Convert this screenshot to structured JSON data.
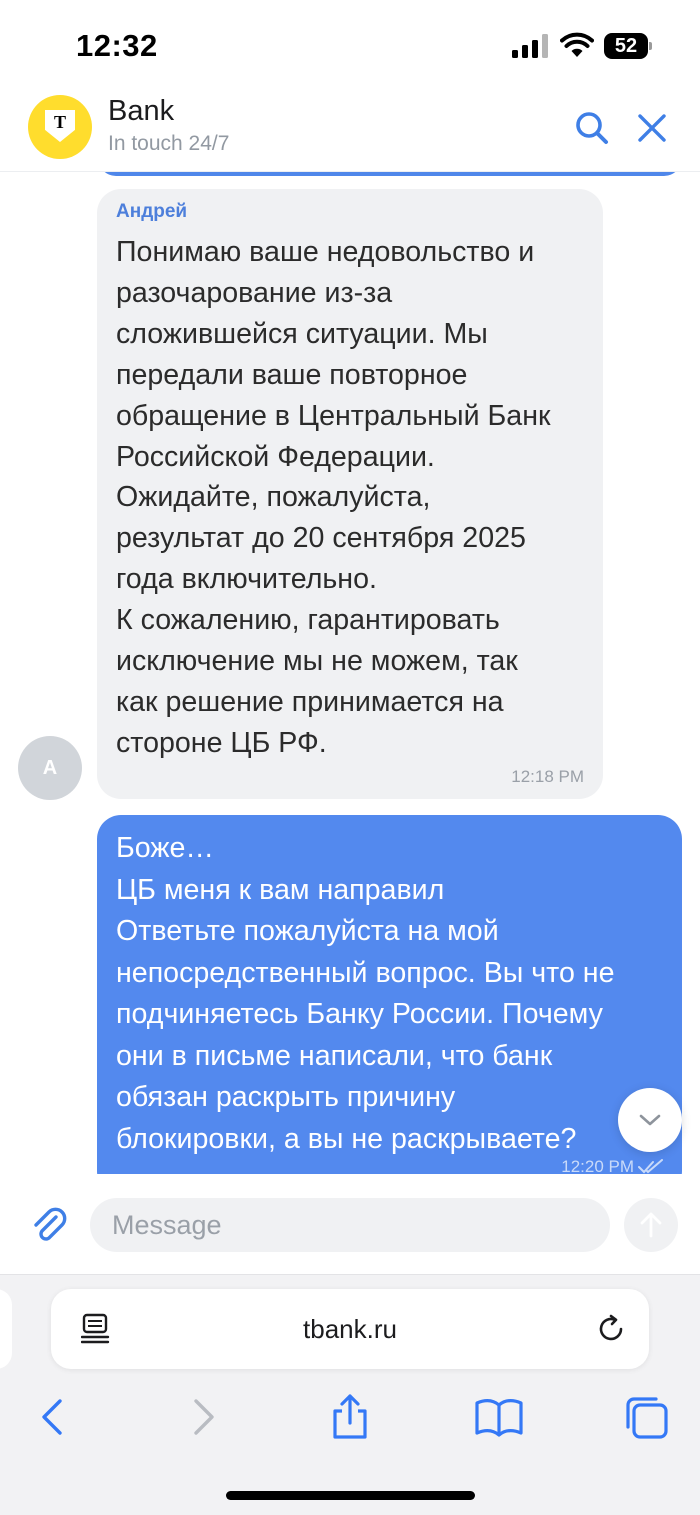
{
  "status_bar": {
    "time": "12:32",
    "battery_level": "52"
  },
  "header": {
    "logo_letter": "T",
    "title": "Bank",
    "subtitle": "In touch 24/7",
    "icons": [
      "search-icon",
      "close-icon"
    ]
  },
  "colors": {
    "accent": "#4f87ea",
    "outgoing_bubble": "#5389ee",
    "incoming_bubble": "#f0f1f3",
    "logo_yellow": "#ffdd2d",
    "sender_name": "#4d7fdb"
  },
  "messages": [
    {
      "direction": "incoming",
      "sender": "Андрей",
      "avatar_letter": "А",
      "text": "Понимаю ваше недовольство и\nразочарование из-за\nсложившейся ситуации. Мы\nпередали ваше повторное\nобращение в Центральный Банк\nРоссийской Федерации.\nОжидайте, пожалуйста,\nрезультат до 20 сентября 2025\nгода включительно.\nК сожалению, гарантировать\nисключение мы не можем, так\nкак решение принимается на\nстороне ЦБ РФ.",
      "time": "12:18 PM"
    },
    {
      "direction": "outgoing",
      "text": "Боже…\nЦБ меня к вам направил\nОтветьте пожалуйста на мой\nнепосредственный вопрос. Вы что не\nподчиняетесь Банку России. Почему\nони в письме написали, что банк\nобязан раскрыть причину\nблокировки, а вы не раскрываете?",
      "time": "12:20 PM",
      "status_icon": "double-check-icon"
    }
  ],
  "composer": {
    "placeholder": "Message",
    "value": "",
    "icons": [
      "paperclip-icon",
      "send-arrow-icon"
    ]
  },
  "browser": {
    "url": "tbank.ru",
    "icons": [
      "reader-mode-icon",
      "reload-icon",
      "back-icon",
      "forward-icon",
      "share-icon",
      "bookmarks-icon",
      "tabs-icon"
    ]
  }
}
